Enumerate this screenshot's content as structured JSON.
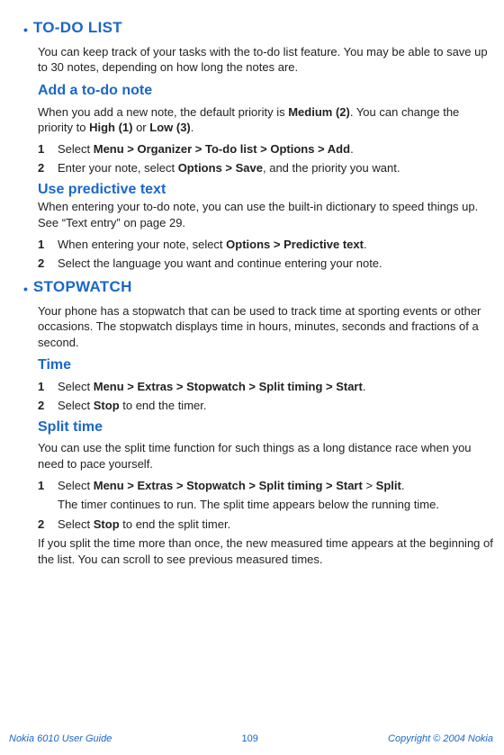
{
  "todo": {
    "title": "TO-DO LIST",
    "intro": "You can keep track of your tasks with the to-do list feature. You may be able to save up to 30 notes, depending on how long the notes are.",
    "add": {
      "title": "Add a to-do note",
      "p1_a": "When you add a new note, the default priority is ",
      "p1_b": "Medium (2)",
      "p1_c": ". You can change the priority to ",
      "p1_d": "High (1)",
      "p1_e": " or ",
      "p1_f": "Low (3)",
      "p1_g": ".",
      "s1_a": "Select ",
      "s1_b": "Menu > Organizer > To-do list > Options > Add",
      "s1_c": ".",
      "s2_a": "Enter your note, select ",
      "s2_b": "Options > Save",
      "s2_c": ", and the priority you want."
    },
    "pred": {
      "title": "Use predictive text",
      "intro": "When entering your to-do note, you can use the built-in dictionary to speed things up. See “Text entry” on page 29.",
      "s1_a": "When entering your note, select ",
      "s1_b": "Options > Predictive text",
      "s1_c": ".",
      "s2": "Select the language you want and continue entering your note."
    }
  },
  "stop": {
    "title": "STOPWATCH",
    "intro": "Your phone has a stopwatch that can be used to track time at sporting events or other occasions. The stopwatch displays time in hours, minutes, seconds and fractions of a second.",
    "time": {
      "title": "Time",
      "s1_a": "Select ",
      "s1_b": "Menu > Extras > Stopwatch > Split timing > Start",
      "s1_c": ".",
      "s2_a": "Select ",
      "s2_b": "Stop",
      "s2_c": " to end the timer."
    },
    "split": {
      "title": "Split time",
      "intro": "You can use the split time function for such things as a long distance race when you need to pace yourself.",
      "s1_a": "Select ",
      "s1_b": "Menu > Extras > Stopwatch > Split timing > Start",
      "s1_c": " > ",
      "s1_d": "Split",
      "s1_e": ".",
      "s1_note": "The timer continues to run. The split time appears below the running time.",
      "s2_a": "Select ",
      "s2_b": "Stop",
      "s2_c": " to end the split timer.",
      "tail": "If you split the time more than once, the new measured time appears at the beginning of the list. You can scroll to see previous measured times."
    }
  },
  "footer": {
    "left": "Nokia 6010 User Guide",
    "page": "109",
    "right": "Copyright © 2004 Nokia"
  }
}
